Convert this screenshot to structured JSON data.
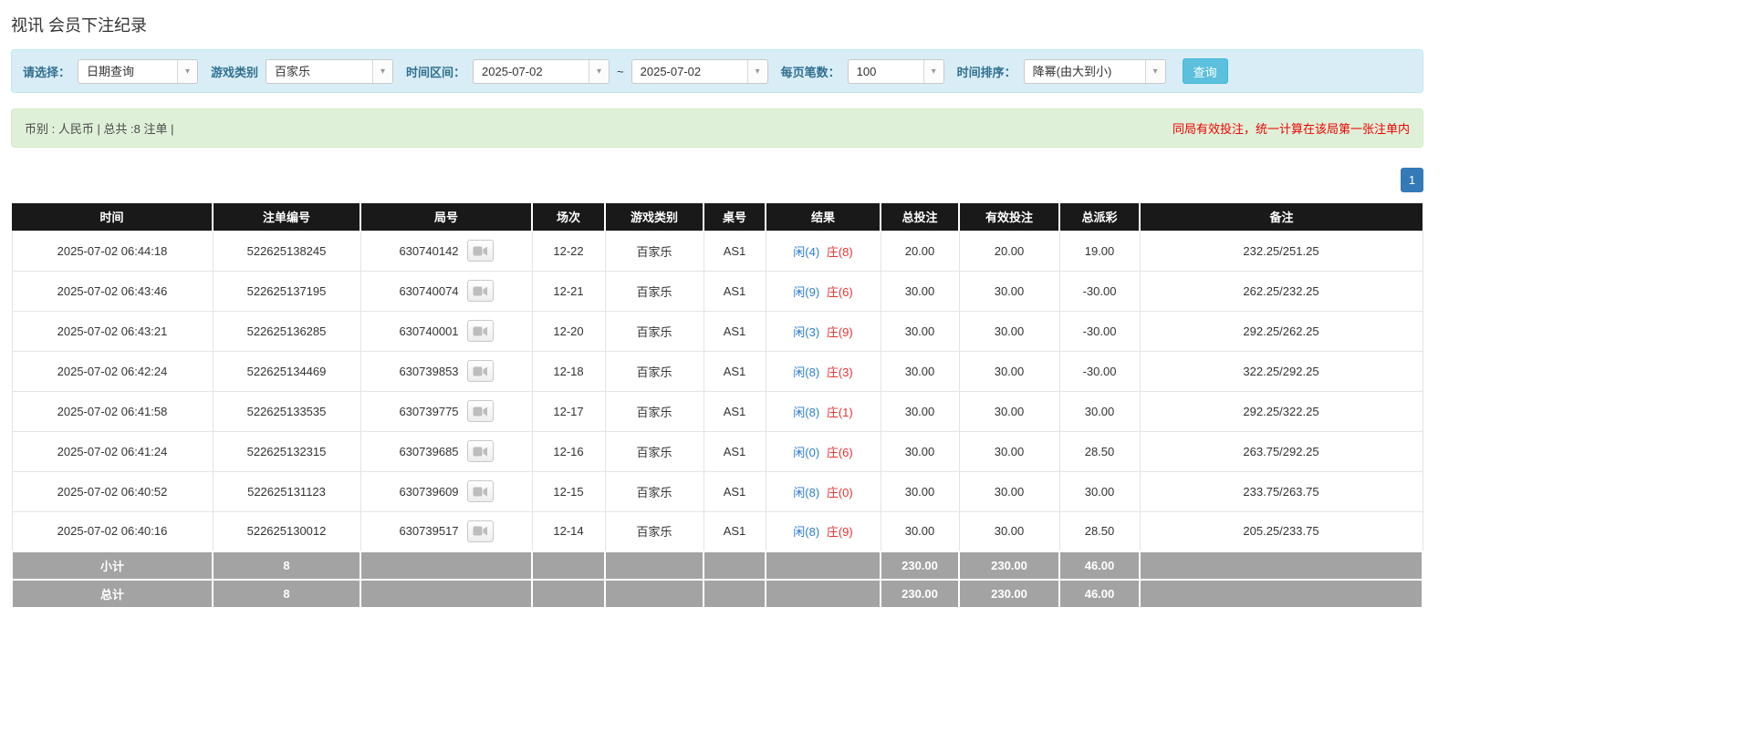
{
  "page": {
    "title": "视讯 会员下注纪录"
  },
  "icons": {
    "dropdown_caret": "▾",
    "round_video_icon": "video-camera"
  },
  "filters": {
    "select_label": "请选择：",
    "select_value": "日期查询",
    "game_type_label": "游戏类别",
    "game_type_value": "百家乐",
    "time_range_label": "时间区间：",
    "time_from": "2025-07-02",
    "tilde": "~",
    "time_to": "2025-07-02",
    "page_size_label": "每页笔数：",
    "page_size_value": "100",
    "sort_label": "时间排序：",
    "sort_value": "降幂(由大到小)",
    "search_button": "查询"
  },
  "summary": {
    "left_text": "币别 : 人民币 | 总共 :8 注单 |",
    "right_notice": "同局有效投注，统一计算在该局第一张注单内"
  },
  "pagination": {
    "current": "1"
  },
  "table": {
    "headers": [
      "时间",
      "注单编号",
      "局号",
      "场次",
      "游戏类别",
      "桌号",
      "结果",
      "总投注",
      "有效投注",
      "总派彩",
      "备注"
    ],
    "rows": [
      {
        "time": "2025-07-02 06:44:18",
        "bet_id": "522625138245",
        "round_id": "630740142",
        "session": "12-22",
        "game": "百家乐",
        "table_no": "AS1",
        "result_player": "闲(4)",
        "result_banker": "庄(8)",
        "total_bet": "20.00",
        "valid_bet": "20.00",
        "payout": "19.00",
        "remark": "232.25/251.25"
      },
      {
        "time": "2025-07-02 06:43:46",
        "bet_id": "522625137195",
        "round_id": "630740074",
        "session": "12-21",
        "game": "百家乐",
        "table_no": "AS1",
        "result_player": "闲(9)",
        "result_banker": "庄(6)",
        "total_bet": "30.00",
        "valid_bet": "30.00",
        "payout": "-30.00",
        "remark": "262.25/232.25"
      },
      {
        "time": "2025-07-02 06:43:21",
        "bet_id": "522625136285",
        "round_id": "630740001",
        "session": "12-20",
        "game": "百家乐",
        "table_no": "AS1",
        "result_player": "闲(3)",
        "result_banker": "庄(9)",
        "total_bet": "30.00",
        "valid_bet": "30.00",
        "payout": "-30.00",
        "remark": "292.25/262.25"
      },
      {
        "time": "2025-07-02 06:42:24",
        "bet_id": "522625134469",
        "round_id": "630739853",
        "session": "12-18",
        "game": "百家乐",
        "table_no": "AS1",
        "result_player": "闲(8)",
        "result_banker": "庄(3)",
        "total_bet": "30.00",
        "valid_bet": "30.00",
        "payout": "-30.00",
        "remark": "322.25/292.25"
      },
      {
        "time": "2025-07-02 06:41:58",
        "bet_id": "522625133535",
        "round_id": "630739775",
        "session": "12-17",
        "game": "百家乐",
        "table_no": "AS1",
        "result_player": "闲(8)",
        "result_banker": "庄(1)",
        "total_bet": "30.00",
        "valid_bet": "30.00",
        "payout": "30.00",
        "remark": "292.25/322.25"
      },
      {
        "time": "2025-07-02 06:41:24",
        "bet_id": "522625132315",
        "round_id": "630739685",
        "session": "12-16",
        "game": "百家乐",
        "table_no": "AS1",
        "result_player": "闲(0)",
        "result_banker": "庄(6)",
        "total_bet": "30.00",
        "valid_bet": "30.00",
        "payout": "28.50",
        "remark": "263.75/292.25"
      },
      {
        "time": "2025-07-02 06:40:52",
        "bet_id": "522625131123",
        "round_id": "630739609",
        "session": "12-15",
        "game": "百家乐",
        "table_no": "AS1",
        "result_player": "闲(8)",
        "result_banker": "庄(0)",
        "total_bet": "30.00",
        "valid_bet": "30.00",
        "payout": "30.00",
        "remark": "233.75/263.75"
      },
      {
        "time": "2025-07-02 06:40:16",
        "bet_id": "522625130012",
        "round_id": "630739517",
        "session": "12-14",
        "game": "百家乐",
        "table_no": "AS1",
        "result_player": "闲(8)",
        "result_banker": "庄(9)",
        "total_bet": "30.00",
        "valid_bet": "30.00",
        "payout": "28.50",
        "remark": "205.25/233.75"
      }
    ],
    "subtotal": {
      "label": "小计",
      "count": "8",
      "total_bet": "230.00",
      "valid_bet": "230.00",
      "payout": "46.00"
    },
    "total": {
      "label": "总计",
      "count": "8",
      "total_bet": "230.00",
      "valid_bet": "230.00",
      "payout": "46.00"
    }
  }
}
